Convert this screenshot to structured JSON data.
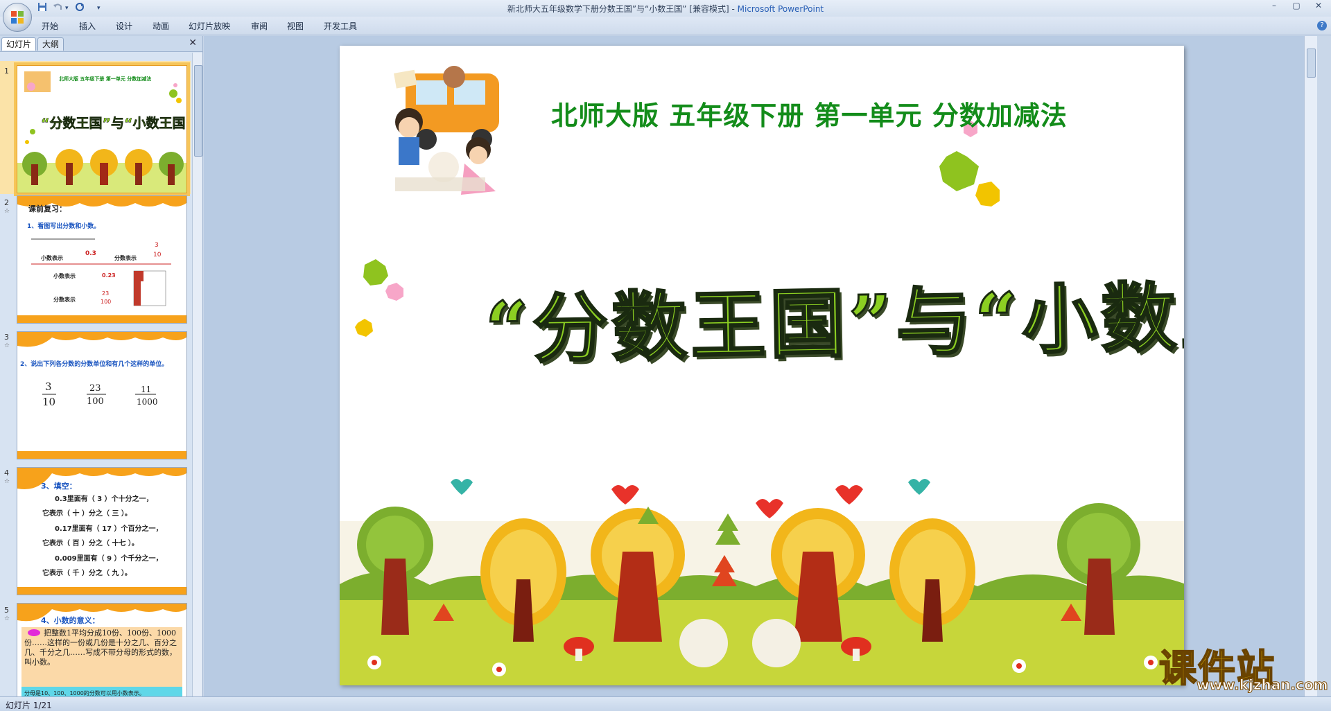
{
  "window": {
    "title_doc": "新北师大五年级数学下册分数王国”与“小数王国” [兼容模式] - ",
    "title_app": "Microsoft PowerPoint",
    "min_label": "–",
    "max_label": "▢",
    "close_label": "✕",
    "help_label": "?"
  },
  "quick_access": {
    "more_label": "▾"
  },
  "ribbon_tabs": [
    "开始",
    "插入",
    "设计",
    "动画",
    "幻灯片放映",
    "审阅",
    "视图",
    "开发工具"
  ],
  "panel": {
    "tab_slides": "幻灯片",
    "tab_outline": "大纲",
    "close_label": "✕"
  },
  "thumbnails": [
    {
      "num": "1",
      "title": "北师大版  五年级下册  第一单元  分数加减法",
      "main": "“分数王国”与“小数王国”"
    },
    {
      "num": "2",
      "title": "课前复习：",
      "line1": "1、看图写出分数和小数。",
      "lbl_dec": "小数表示",
      "val_dec": "0.3",
      "lbl_frac": "分数表示",
      "frac_num": "3",
      "frac_den": "10",
      "lbl_dec2": "小数表示",
      "val_dec2": "0.23",
      "lbl_frac2": "分数表示",
      "frac2_num": "23",
      "frac2_den": "100"
    },
    {
      "num": "3",
      "line1": "2、说出下列各分数的分数单位和有几个这样的单位。",
      "f1n": "3",
      "f1d": "10",
      "f2n": "23",
      "f2d": "100",
      "f3n": "11",
      "f3d": "1000"
    },
    {
      "num": "4",
      "title": "3、填空：",
      "l1": "0.3里面有（ 3 ）个十分之一，",
      "l2": "它表示（ 十 ）分之（ 三 ）。",
      "l3": "0.17里面有（ 17 ）个百分之一，",
      "l4": "它表示（ 百 ）分之（ 十七 ）。",
      "l5": "0.009里面有（ 9 ）个千分之一，",
      "l6": "它表示（ 千 ）分之（ 九 ）。"
    },
    {
      "num": "5",
      "title": "4、小数的意义：",
      "body": "把整数1平均分成10份、100份、1000份……这样的一份或几份是十分之几、百分之几、千分之几……写成不带分母的形式的数，叫小数。",
      "foot": "分母是10、100、1000的分数可以用小数表示。"
    }
  ],
  "slide": {
    "subtitle": "北师大版  五年级下册  第一单元  分数加减法",
    "main_title": "“分数王国”与“小数王国”"
  },
  "status": {
    "text": "幻灯片 1/21"
  },
  "watermark": {
    "big": "课件站",
    "url": "www.kjzhan.com"
  },
  "colors": {
    "subtitle_green": "#138c1a",
    "title_lime": "#8ccf22",
    "accent_orange": "#f7a21b",
    "pink": "#f7a6c8",
    "yellow": "#f2c400"
  }
}
